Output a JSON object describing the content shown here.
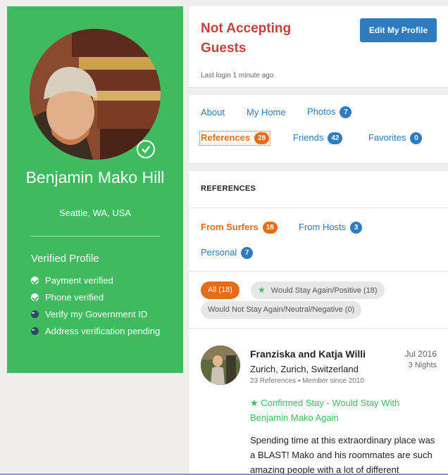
{
  "profile": {
    "name": "Benjamin Mako Hill",
    "location": "Seattle, WA, USA",
    "verified_title": "Verified Profile",
    "verifications": [
      {
        "label": "Payment verified",
        "status": "ok"
      },
      {
        "label": "Phone verified",
        "status": "ok"
      },
      {
        "label": "Verify my Government ID",
        "status": "pending"
      },
      {
        "label": "Address verification pending",
        "status": "pending"
      }
    ]
  },
  "status": {
    "title": "Not Accepting Guests",
    "last_login": "Last login 1 minute ago",
    "edit_button": "Edit My Profile"
  },
  "nav": {
    "about": "About",
    "my_home": "My Home",
    "photos": {
      "label": "Photos",
      "count": "7"
    },
    "references": {
      "label": "References",
      "count": "28"
    },
    "friends": {
      "label": "Friends",
      "count": "42"
    },
    "favorites": {
      "label": "Favorites",
      "count": "0"
    }
  },
  "references": {
    "heading": "REFERENCES",
    "tabs": {
      "from_surfers": {
        "label": "From Surfers",
        "count": "18"
      },
      "from_hosts": {
        "label": "From Hosts",
        "count": "3"
      },
      "personal": {
        "label": "Personal",
        "count": "7"
      }
    },
    "filters": {
      "all": "All (18)",
      "positive": "Would Stay Again/Positive (18)",
      "negative": "Would Not Stay Again/Neutral/Negative (0)"
    },
    "items": [
      {
        "name": "Franziska and Katja Willi",
        "date": "Jul 2016",
        "nights": "3 Nights",
        "location": "Zurich, Zurich, Switzerland",
        "meta": "23 References • Member since 2010",
        "confirmed": "Confirmed Stay - Would Stay With Benjamin Mako Again",
        "body": "Spending time at this extraordinary place was a BLAST! Mako and his roommates are such amazing people with a lot of different"
      }
    ]
  },
  "colors": {
    "brand_green": "#3fba5f",
    "link_blue": "#2f7bbf",
    "accent_orange": "#e76c17",
    "alert_red": "#c6403d"
  }
}
